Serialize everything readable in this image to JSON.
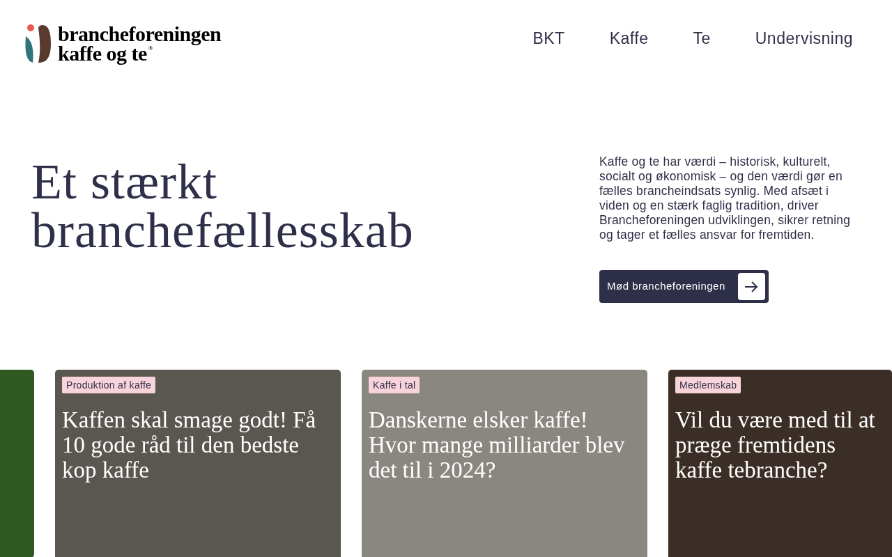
{
  "logo": {
    "line_1": "brancheforeningen",
    "line_2": "kaffe og te",
    "mark": "®"
  },
  "nav": [
    {
      "label": "BKT"
    },
    {
      "label": "Kaffe"
    },
    {
      "label": "Te"
    },
    {
      "label": "Undervisning"
    }
  ],
  "hero": {
    "heading": "Et stærkt branchefællesskab",
    "text": "Kaffe og te har værdi – historisk, kulturelt, socialt og økonomisk – og den værdi gør en fælles brancheindsats synlig. Med afsæt i viden og en stærk faglig tradition, driver Brancheforeningen udviklingen, sikrer retning og tager et fælles ansvar for fremtiden.",
    "button": "Mød brancheforeningen"
  },
  "cards": [
    {
      "kind": "partial"
    },
    {
      "kind": "article",
      "tag": "Produktion af kaffe",
      "title": "Kaffen skal smage godt! Få 10 gode råd til den bedste kop kaffe"
    },
    {
      "kind": "article",
      "tag": "Kaffe i tal",
      "title": "Danskerne elsker kaffe! Hvor mange milliarder blev det til i 2024?"
    },
    {
      "kind": "article",
      "tag": "Medlemskab",
      "title": "Vil du være med til at præge fremtidens kaffe tebranche?"
    }
  ]
}
